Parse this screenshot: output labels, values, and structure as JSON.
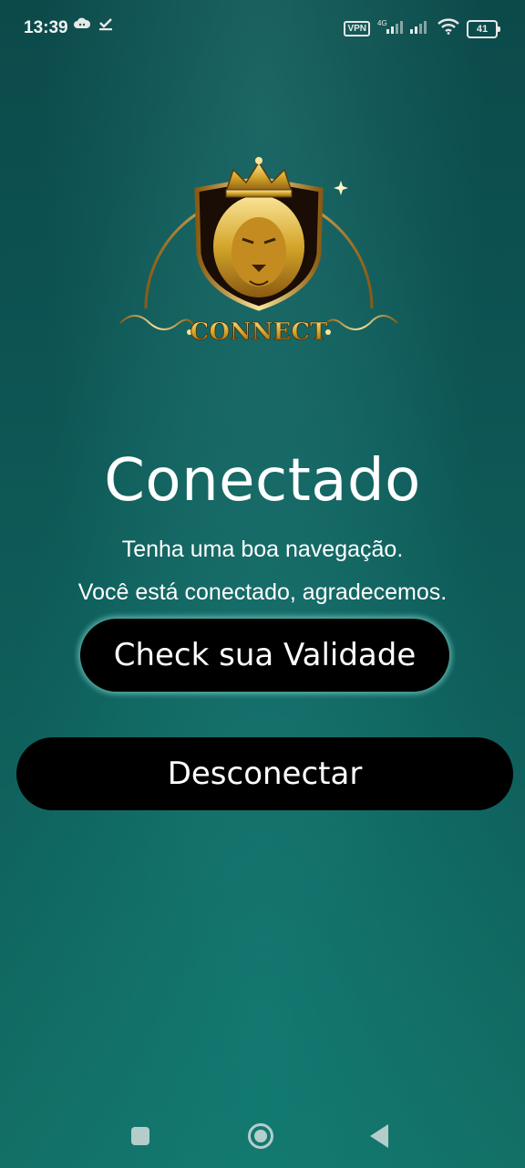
{
  "status_bar": {
    "time": "13:39",
    "vpn_label": "VPN",
    "network_label": "4G",
    "battery_level": "41",
    "icons": [
      "cloud-icon",
      "download-check-icon",
      "signal-icon",
      "wifi-icon",
      "battery-icon"
    ]
  },
  "logo": {
    "text": "CONNECT"
  },
  "main": {
    "title": "Conectado",
    "subtitle_1": "Tenha uma boa navegação.",
    "subtitle_2": "Você está conectado, agradecemos.",
    "check_validity_label": "Check sua Validade",
    "disconnect_label": "Desconectar"
  },
  "nav_bar": {
    "icons": [
      "recents-icon",
      "home-icon",
      "back-icon"
    ]
  },
  "colors": {
    "background": "#0d5554",
    "button": "#000000",
    "gold": "#d4a62a",
    "glow": "#8ce1d7"
  }
}
